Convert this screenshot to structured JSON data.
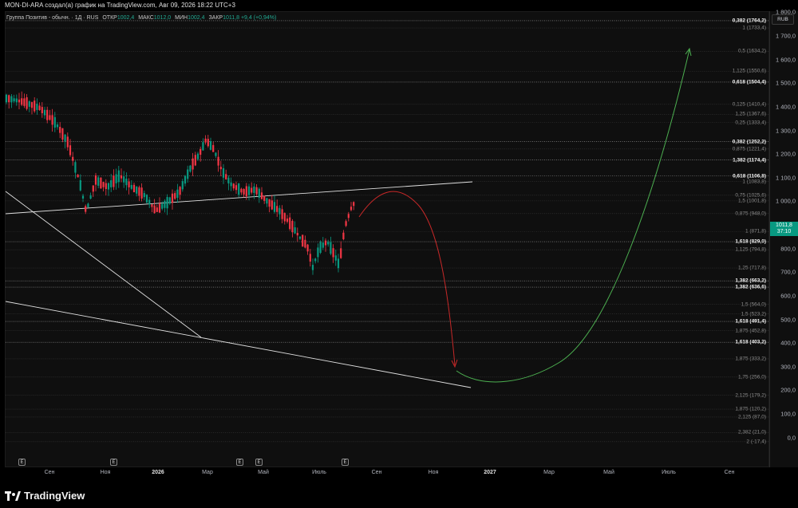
{
  "header": {
    "author_line": "MON-DI-ARA создал(а) график на TradingView.com, Авг 09, 2026 18:22 UTC+3"
  },
  "legend": {
    "symbol": "Группа Позитив - обычн. · 1Д · RUS",
    "o_label": "ОТКР",
    "o": "1002,4",
    "h_label": "МАКС",
    "h": "1012,0",
    "l_label": "МИН",
    "l": "1002,4",
    "c_label": "ЗАКР",
    "c": "1011,8",
    "change": "+9,4 (+0,94%)"
  },
  "price_axis": {
    "currency": "RUB",
    "ticks": [
      "1 800,0",
      "1 700,0",
      "1 600,0",
      "1 500,0",
      "1 400,0",
      "1 300,0",
      "1 200,0",
      "1 100,0",
      "1 000,0",
      "900,0",
      "800,0",
      "700,0",
      "600,0",
      "500,0",
      "400,0",
      "300,0",
      "200,0",
      "100,0",
      "0,0"
    ],
    "last_price": "1011,8",
    "countdown": "37:10"
  },
  "fib_levels": [
    {
      "label": "0,382 (1764,2)",
      "major": true
    },
    {
      "label": "1 (1733,4)",
      "major": false
    },
    {
      "label": "0,5 (1634,2)",
      "major": false
    },
    {
      "label": "1,125 (1550,6)",
      "major": false
    },
    {
      "label": "0,618 (1504,4)",
      "major": true
    },
    {
      "label": "0,125 (1410,4)",
      "major": false
    },
    {
      "label": "1,25 (1367,6)",
      "major": false
    },
    {
      "label": "0,25 (1333,4)",
      "major": false
    },
    {
      "label": "0,382 (1252,2)",
      "major": true
    },
    {
      "label": "0,875 (1221,4)",
      "major": false
    },
    {
      "label": "1,382 (1174,4)",
      "major": true
    },
    {
      "label": "0,618 (1106,8)",
      "major": true
    },
    {
      "label": "1 (1083,8)",
      "major": false
    },
    {
      "label": "0,75 (1025,6)",
      "major": false
    },
    {
      "label": "1,5 (1001,8)",
      "major": false
    },
    {
      "label": "0,875 (948,0)",
      "major": false
    },
    {
      "label": "1 (871,8)",
      "major": false
    },
    {
      "label": "1,618 (829,0)",
      "major": true
    },
    {
      "label": "1,125 (794,8)",
      "major": false
    },
    {
      "label": "1,25 (717,8)",
      "major": false
    },
    {
      "label": "1,382 (663,2)",
      "major": true
    },
    {
      "label": "1,382 (636,6)",
      "major": true
    },
    {
      "label": "1,5 (564,0)",
      "major": false
    },
    {
      "label": "1,5 (523,2)",
      "major": false
    },
    {
      "label": "1,618 (491,4)",
      "major": true
    },
    {
      "label": "1,875 (452,8)",
      "major": false
    },
    {
      "label": "1,618 (403,2)",
      "major": true
    },
    {
      "label": "1,875 (333,2)",
      "major": false
    },
    {
      "label": "1,75 (256,0)",
      "major": false
    },
    {
      "label": "2,125 (179,2)",
      "major": false
    },
    {
      "label": "1,875 (120,2)",
      "major": false
    },
    {
      "label": "2,125 (87,0)",
      "major": false
    },
    {
      "label": "2,382 (21,0)",
      "major": false
    },
    {
      "label": "2 (-17,4)",
      "major": false
    }
  ],
  "time_axis": {
    "labels": [
      {
        "t": "Сен",
        "bold": false
      },
      {
        "t": "Ноя",
        "bold": false
      },
      {
        "t": "2026",
        "bold": true
      },
      {
        "t": "Мар",
        "bold": false
      },
      {
        "t": "Май",
        "bold": false
      },
      {
        "t": "Июль",
        "bold": false
      },
      {
        "t": "Сен",
        "bold": false
      },
      {
        "t": "Ноя",
        "bold": false
      },
      {
        "t": "2027",
        "bold": true
      },
      {
        "t": "Мар",
        "bold": false
      },
      {
        "t": "Май",
        "bold": false
      },
      {
        "t": "Июль",
        "bold": false
      },
      {
        "t": "Сен",
        "bold": false
      }
    ]
  },
  "earnings_markers": {
    "label": "E",
    "count": 5
  },
  "colors": {
    "up": "#089981",
    "down": "#f23645",
    "projection_down": "#c62828",
    "projection_up": "#4caf50",
    "trendline": "#e0e0e0"
  },
  "branding": {
    "name": "TradingView"
  }
}
